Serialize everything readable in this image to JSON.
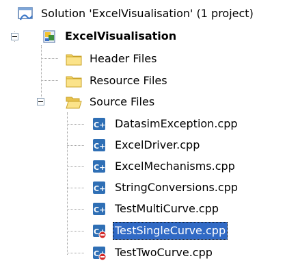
{
  "tree": {
    "solution": {
      "label": "Solution 'ExcelVisualisation' (1 project)",
      "icon": "solution-icon"
    },
    "project": {
      "label": "ExcelVisualisation",
      "icon": "project-icon",
      "expanded": true
    },
    "folders": [
      {
        "label": "Header Files",
        "icon": "folder-closed-icon"
      },
      {
        "label": "Resource Files",
        "icon": "folder-closed-icon"
      },
      {
        "label": "Source Files",
        "icon": "folder-open-icon",
        "expanded": true
      }
    ],
    "files": [
      {
        "label": "DatasimException.cpp",
        "icon": "cpp-file-icon"
      },
      {
        "label": "ExcelDriver.cpp",
        "icon": "cpp-file-icon"
      },
      {
        "label": "ExcelMechanisms.cpp",
        "icon": "cpp-file-icon"
      },
      {
        "label": "StringConversions.cpp",
        "icon": "cpp-file-icon"
      },
      {
        "label": "TestMultiCurve.cpp",
        "icon": "cpp-file-icon"
      },
      {
        "label": "TestSingleCurve.cpp",
        "icon": "cpp-file-excluded-icon",
        "selected": true
      },
      {
        "label": "TestTwoCurve.cpp",
        "icon": "cpp-file-excluded-icon"
      }
    ]
  },
  "colors": {
    "selection": "#316ac5",
    "folder": "#f5d66b",
    "cpp_badge": "#2f6fb5",
    "excluded_mark": "#d42a2a"
  }
}
